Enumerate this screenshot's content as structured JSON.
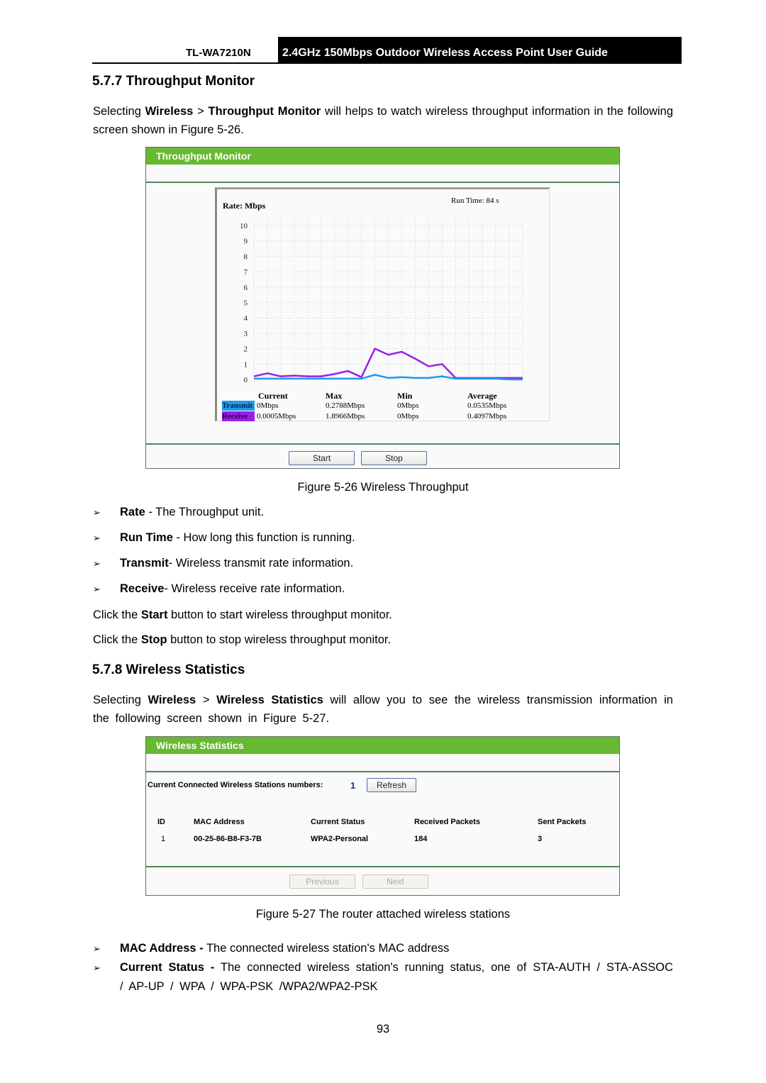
{
  "header": {
    "model": "TL-WA7210N",
    "guide_title": "2.4GHz 150Mbps Outdoor Wireless Access Point User Guide"
  },
  "section_577": {
    "heading": "5.7.7  Throughput Monitor",
    "intro_pre": "Selecting ",
    "intro_b1": "Wireless",
    "intro_mid": " > ",
    "intro_b2": "Throughput Monitor",
    "intro_post": " will helps to watch wireless throughput information in the following screen shown in Figure 5-26.",
    "figure_caption": "Figure 5-26 Wireless Throughput",
    "bullets": [
      {
        "term": "Rate",
        "desc": " - The Throughput unit."
      },
      {
        "term": "Run Time",
        "desc": " - How long this function is running."
      },
      {
        "term": "Transmit",
        "desc": "- Wireless transmit rate information."
      },
      {
        "term": "Receive",
        "desc": "- Wireless receive rate information."
      }
    ],
    "start_note": {
      "pre": "Click the ",
      "b": "Start",
      "post": " button to start wireless throughput monitor."
    },
    "stop_note": {
      "pre": "Click the ",
      "b": "Stop",
      "post": " button to stop wireless throughput monitor."
    }
  },
  "throughput_panel": {
    "title": "Throughput Monitor",
    "start_label": "Start",
    "stop_label": "Stop",
    "stats_headers": [
      "Current",
      "Max",
      "Min",
      "Average"
    ],
    "transmit": {
      "label": "Transmit",
      "color": "#1e9be8",
      "current": "0Mbps",
      "max": "0.2788Mbps",
      "min": "0Mbps",
      "average": "0.0535Mbps"
    },
    "receive": {
      "label": "Receive",
      "color": "#9b1ee8",
      "current": "0.0005Mbps",
      "max": "1.8966Mbps",
      "min": "0Mbps",
      "average": "0.4097Mbps"
    }
  },
  "chart_data": {
    "type": "line",
    "title": "Rate: Mbps",
    "annotation": "Run Time: 84 s",
    "xlabel": "",
    "ylabel": "Rate: Mbps",
    "ylim": [
      0,
      10
    ],
    "yticks": [
      "0",
      "1",
      "2",
      "3",
      "4",
      "5",
      "6",
      "7",
      "8",
      "9",
      "10"
    ],
    "grid": true,
    "x": [
      0,
      1,
      2,
      3,
      4,
      5,
      6,
      7,
      8,
      9,
      10,
      11,
      12,
      13,
      14,
      15,
      16,
      17,
      18,
      19,
      20
    ],
    "series": [
      {
        "name": "Receive",
        "color": "#9b1ee8",
        "values": [
          0.2,
          0.4,
          0.2,
          0.25,
          0.2,
          0.2,
          0.35,
          0.55,
          0.15,
          2.0,
          1.6,
          1.8,
          1.35,
          0.85,
          1.0,
          0.1,
          0.1,
          0.1,
          0.1,
          0.1,
          0.1
        ]
      },
      {
        "name": "Transmit",
        "color": "#1e9be8",
        "values": [
          0.05,
          0.05,
          0.05,
          0.05,
          0.05,
          0.05,
          0.05,
          0.05,
          0.05,
          0.3,
          0.1,
          0.15,
          0.1,
          0.1,
          0.2,
          0.05,
          0.05,
          0.05,
          0.05,
          0.0,
          0.0
        ]
      }
    ]
  },
  "section_578": {
    "heading": "5.7.8  Wireless Statistics",
    "intro_pre": "Selecting ",
    "intro_b1": "Wireless",
    "intro_mid": " > ",
    "intro_b2": "Wireless Statistics",
    "intro_post": " will allow you to see the wireless transmission information in the following screen shown in Figure 5-27.",
    "figure_caption": "Figure 5-27 The router attached wireless stations",
    "bullets": [
      {
        "term": "MAC Address -",
        "desc": " The connected wireless station's MAC address"
      },
      {
        "term": "Current Status -",
        "desc": " The connected wireless station's running status, one of STA-AUTH / STA-ASSOC / AP-UP / WPA / WPA-PSK /WPA2/WPA2-PSK"
      }
    ]
  },
  "stats_panel": {
    "title": "Wireless Statistics",
    "stations_label": "Current Connected Wireless Stations numbers:",
    "stations_count": "1",
    "refresh_label": "Refresh",
    "columns": [
      "ID",
      "MAC Address",
      "Current Status",
      "Received Packets",
      "Sent Packets"
    ],
    "rows": [
      [
        "1",
        "00-25-86-B8-F3-7B",
        "WPA2-Personal",
        "184",
        "3"
      ]
    ],
    "previous_label": "Previous",
    "next_label": "Next"
  },
  "page_number": "93"
}
